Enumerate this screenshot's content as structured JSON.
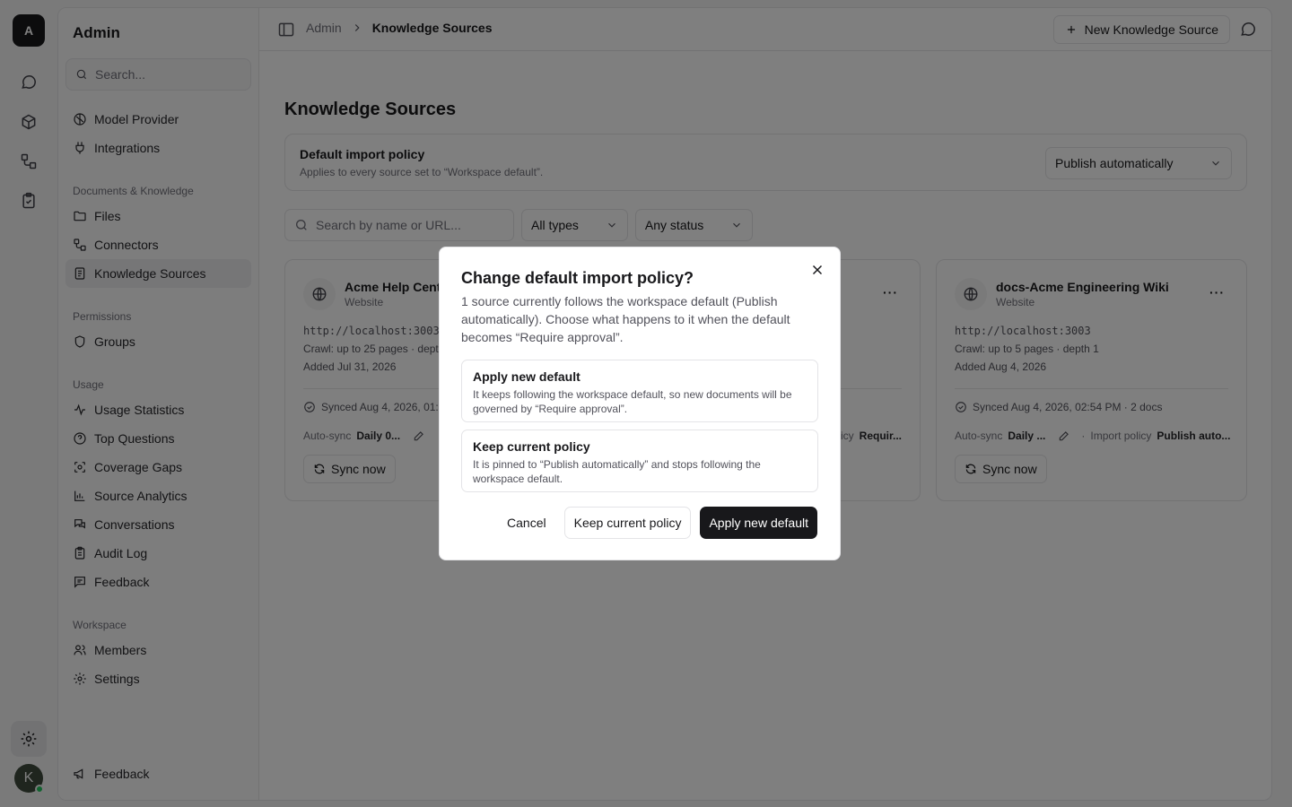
{
  "rail": {
    "workspace_initial": "A",
    "user_initial": "K"
  },
  "sidebar": {
    "title": "Admin",
    "search_placeholder": "Search...",
    "top_items": [
      {
        "label": "Model Provider",
        "icon": "brain-icon"
      },
      {
        "label": "Integrations",
        "icon": "plug-icon"
      }
    ],
    "groups": [
      {
        "label": "Documents & Knowledge",
        "items": [
          "Files",
          "Connectors",
          "Knowledge Sources"
        ]
      },
      {
        "label": "Permissions",
        "items": [
          "Groups"
        ]
      },
      {
        "label": "Usage",
        "items": [
          "Usage Statistics",
          "Top Questions",
          "Coverage Gaps",
          "Source Analytics",
          "Conversations",
          "Audit Log",
          "Feedback"
        ]
      },
      {
        "label": "Workspace",
        "items": [
          "Members",
          "Settings"
        ]
      }
    ],
    "footer_item": "Feedback"
  },
  "topbar": {
    "breadcrumb": [
      "Admin",
      "Knowledge Sources"
    ],
    "new_button": "New Knowledge Source"
  },
  "main": {
    "title": "Knowledge Sources",
    "policy": {
      "title": "Default import policy",
      "subtitle": "Applies to every source set to “Workspace default”.",
      "selected": "Publish automatically"
    },
    "filters": {
      "search_placeholder": "Search by name or URL...",
      "type": "All types",
      "status": "Any status"
    },
    "cards": [
      {
        "name": "Acme Help Center",
        "kind": "Website",
        "url": "http://localhost:3003",
        "crawl": "Crawl: up to 25 pages · depth 2",
        "added": "Added Jul 31, 2026",
        "synced": "Synced Aug 4, 2026, 01:",
        "autosync_label": "Auto-sync",
        "autosync_value": "Daily 0...",
        "sync_button": "Sync now"
      },
      {
        "import_label": "Import policy",
        "import_value": "Requir..."
      },
      {
        "name": "docs-Acme Engineering Wiki",
        "kind": "Website",
        "url": "http://localhost:3003",
        "crawl": "Crawl: up to 5 pages · depth 1",
        "added": "Added Aug 4, 2026",
        "synced": "Synced Aug 4, 2026, 02:54 PM · 2 docs",
        "autosync_label": "Auto-sync",
        "autosync_value": "Daily ...",
        "import_label": "Import policy",
        "import_value": "Publish auto...",
        "sync_button": "Sync now"
      }
    ]
  },
  "dialog": {
    "title": "Change default import policy?",
    "description": "1 source currently follows the workspace default (Publish automatically). Choose what happens to it when the default becomes “Require approval”.",
    "options": [
      {
        "title": "Apply new default",
        "desc": "It keeps following the workspace default, so new documents will be governed by “Require approval”."
      },
      {
        "title": "Keep current policy",
        "desc": "It is pinned to “Publish automatically” and stops following the workspace default."
      }
    ],
    "cancel": "Cancel",
    "keep": "Keep current policy",
    "apply": "Apply new default"
  }
}
